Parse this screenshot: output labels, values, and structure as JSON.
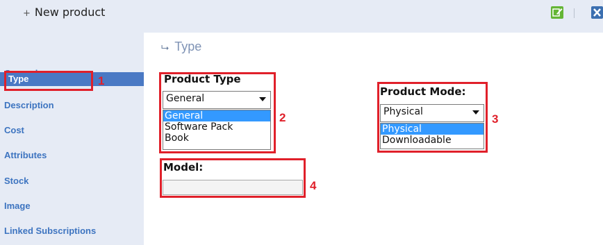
{
  "header": {
    "new_product": "New product",
    "plus_glyph": "+"
  },
  "toolbar": {
    "edit_icon": "edit-icon",
    "close_icon": "close-icon"
  },
  "sidebar": {
    "items": [
      {
        "label": "General"
      },
      {
        "label": "Type",
        "active": true
      },
      {
        "label": "Description"
      },
      {
        "label": "Cost"
      },
      {
        "label": "Attributes"
      },
      {
        "label": "Stock"
      },
      {
        "label": "Image"
      },
      {
        "label": "Linked Subscriptions"
      }
    ]
  },
  "main": {
    "title": "Type",
    "title_icon": "type-icon",
    "product_type": {
      "label": "Product Type",
      "selected": "General",
      "options": [
        "General",
        "Software Pack",
        "Book"
      ]
    },
    "product_mode": {
      "label": "Product Mode:",
      "selected": "Physical",
      "options": [
        "Physical",
        "Downloadable"
      ]
    },
    "model": {
      "label": "Model:",
      "value": ""
    }
  },
  "annotations": [
    "1",
    "2",
    "3",
    "4"
  ],
  "colors": {
    "annotation": "#e0202a",
    "accent": "#4a79c4",
    "selected_option": "#3399ff"
  }
}
